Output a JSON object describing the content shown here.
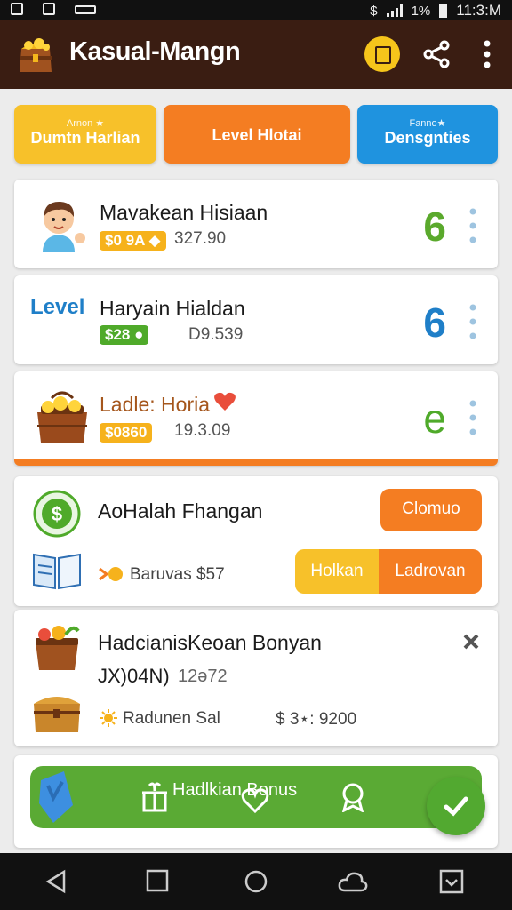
{
  "statusbar": {
    "time": "11:3:M",
    "battery_text": "1%"
  },
  "appbar": {
    "title": "Kasual-Mangn",
    "logo_icon": "treasure-chest-icon",
    "actions": [
      "coin-icon",
      "share-icon",
      "more-vert-icon"
    ]
  },
  "tabs": [
    {
      "small": "Arnon ★",
      "label": "Dumtn Harlian",
      "color": "#f7c12a"
    },
    {
      "small": "",
      "label": "Level Hlotai",
      "color": "#f47d22"
    },
    {
      "small": "Fanno★",
      "label": "Densgnties",
      "color": "#1f93df"
    }
  ],
  "rows": [
    {
      "name": "Mavakean Hisiaan",
      "chip": "$0 9A ◆",
      "chip_color": "#f6b21c",
      "sub": "327.90",
      "big": "6",
      "big_color": "#5aa92c",
      "avatar_icon": "boy-avatar-icon"
    },
    {
      "name": "Haryain Hialdan",
      "leading": "Level",
      "chip": "$28 ●",
      "chip_color": "#4faa2a",
      "sub": "D9.539",
      "big": "6",
      "big_color": "#1f7fc8"
    },
    {
      "name": "Ladle: Horia",
      "chip": "$0860",
      "chip_color": "#f6b21c",
      "sub": "19.3.09",
      "big": "e",
      "big_color": "#4faa2a",
      "avatar_icon": "gold-chest-icon"
    }
  ],
  "bonus_card": {
    "title": "AoHalah Fhangan",
    "button": "Clomuo",
    "label": "Baruvas $57",
    "btn_left": "Holkan",
    "btn_right": "Ladrovan"
  },
  "detail_card": {
    "title": "HadcianisKeoan Bonyan",
    "code": "JX)04N)",
    "code_value": "12ə72",
    "line": "Radunen Sal",
    "amount": "$ 3⋆: 9200"
  },
  "green_banner": {
    "label": "Hadlkian Bonus"
  },
  "navbar": [
    "back-icon",
    "recents-icon",
    "home-icon",
    "cloud-icon",
    "download-box-icon"
  ]
}
